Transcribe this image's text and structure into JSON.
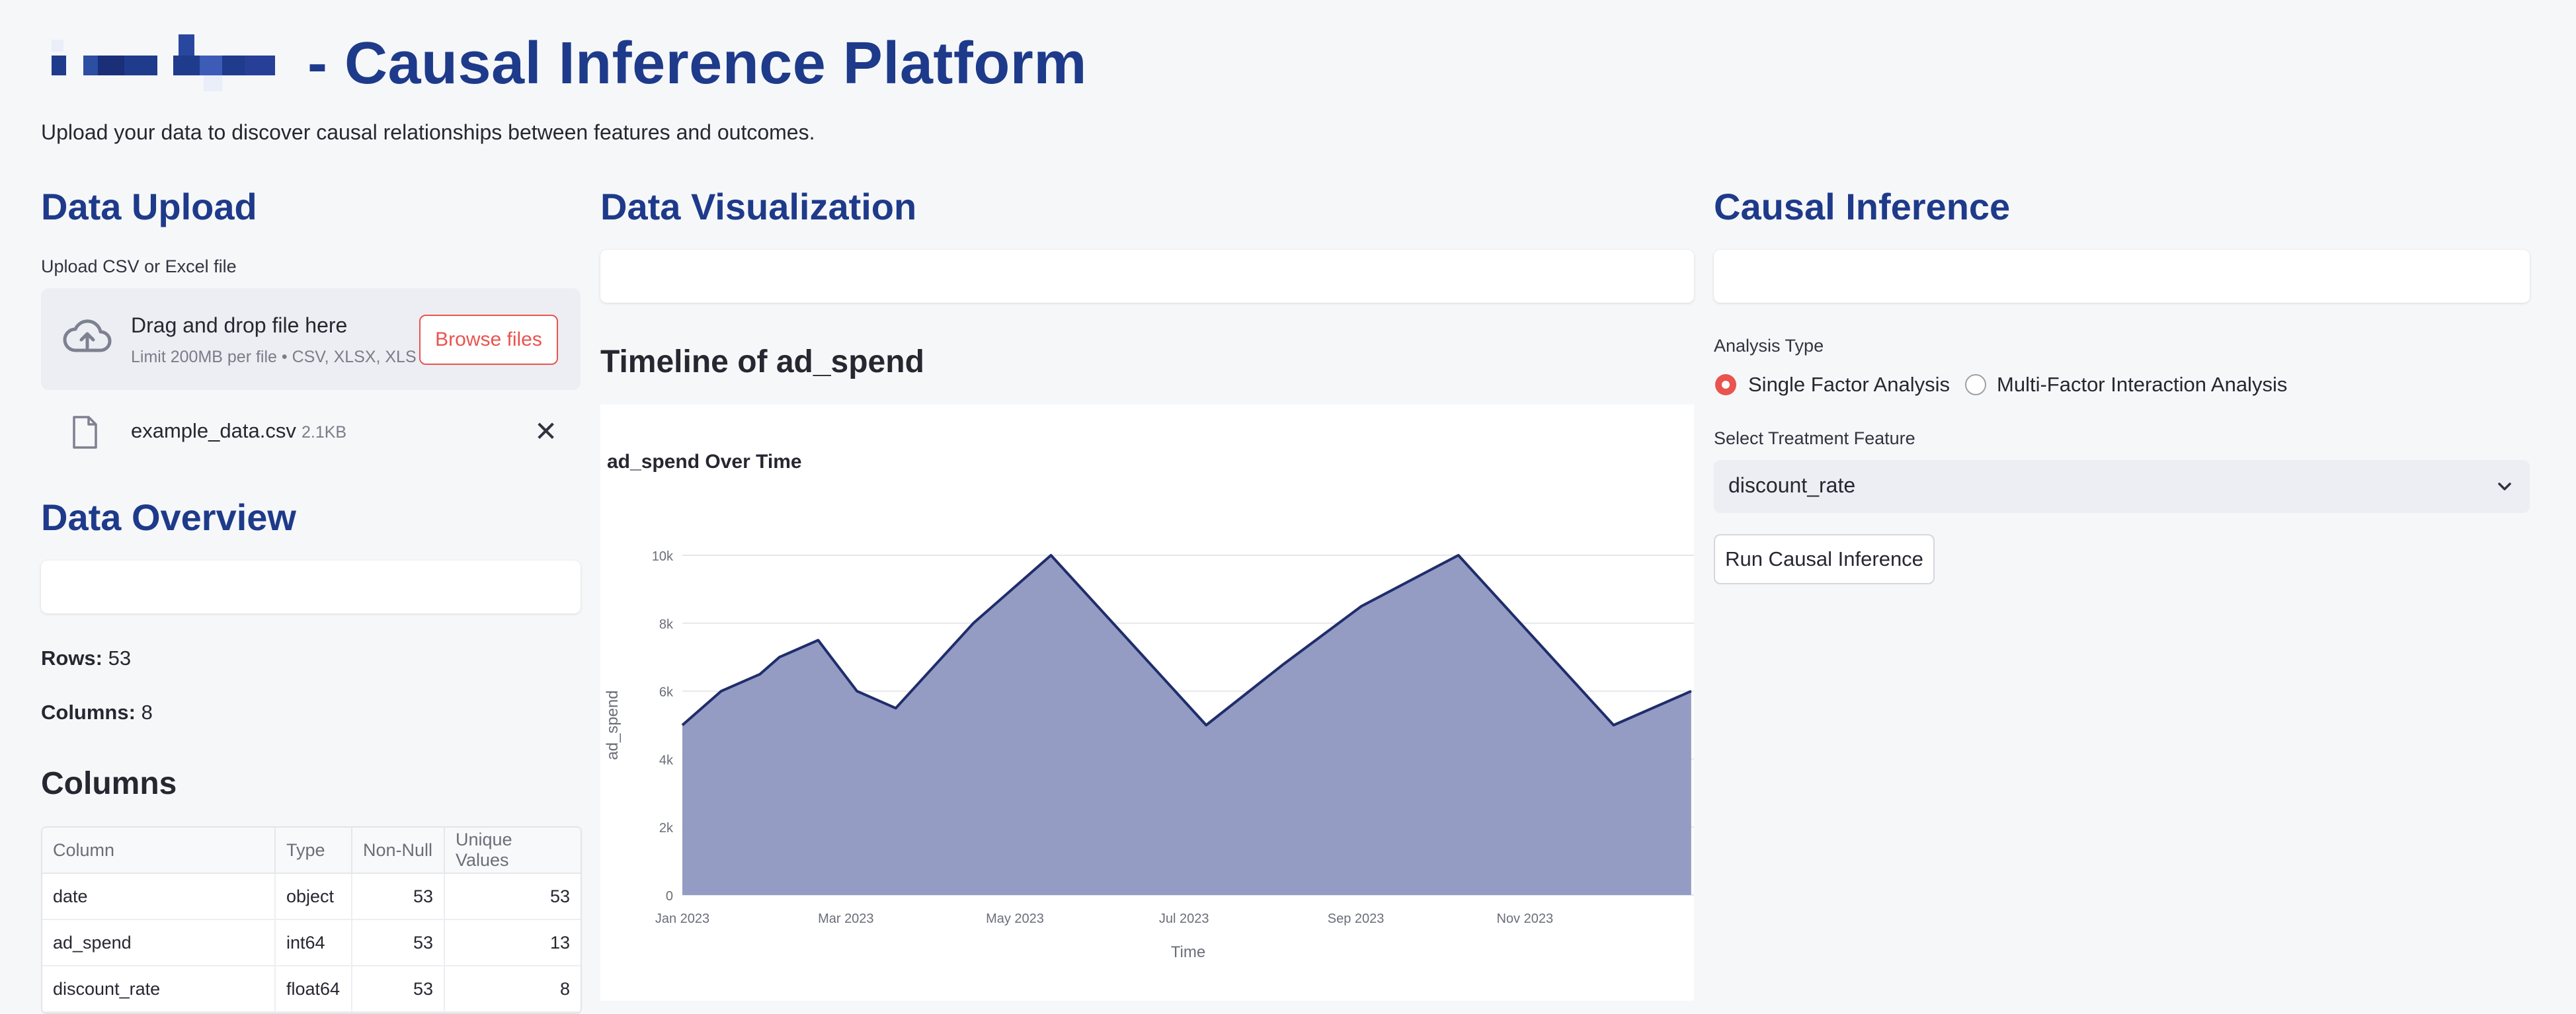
{
  "header": {
    "title": "- Causal Inference Platform",
    "subtitle": "Upload your data to discover causal relationships between features and outcomes."
  },
  "upload": {
    "heading": "Data Upload",
    "label": "Upload CSV or Excel file",
    "drop_text": "Drag and drop file here",
    "limit_text": "Limit 200MB per file • CSV, XLSX, XLS",
    "browse_label": "Browse files",
    "file_name": "example_data.csv",
    "file_size": "2.1KB",
    "close_glyph": "✕"
  },
  "overview": {
    "heading": "Data Overview",
    "rows_label": "Rows:",
    "rows_value": "53",
    "columns_label": "Columns:",
    "columns_value": "8"
  },
  "columns_section": {
    "heading": "Columns",
    "headers": [
      "Column",
      "Type",
      "Non-Null",
      "Unique Values"
    ],
    "rows": [
      [
        "date",
        "object",
        "53",
        "53"
      ],
      [
        "ad_spend",
        "int64",
        "53",
        "13"
      ],
      [
        "discount_rate",
        "float64",
        "53",
        "8"
      ]
    ]
  },
  "visualization": {
    "heading": "Data Visualization",
    "subheading": "Timeline of ad_spend"
  },
  "causal": {
    "heading": "Causal Inference",
    "analysis_type_label": "Analysis Type",
    "options": [
      "Single Factor Analysis",
      "Multi-Factor Interaction Analysis"
    ],
    "selected_option": "Single Factor Analysis",
    "treatment_label": "Select Treatment Feature",
    "treatment_value": "discount_rate",
    "run_label": "Run Causal Inference"
  },
  "colors": {
    "accent": "#e9544f",
    "heading_blue": "#1e3a8a",
    "area_fill": "#8e97c0",
    "line": "#1f2d6b"
  },
  "chart_data": {
    "type": "area",
    "title": "ad_spend Over Time",
    "xlabel": "Time",
    "ylabel": "ad_spend",
    "x_ticks": [
      "Jan 2023",
      "Mar 2023",
      "May 2023",
      "Jul 2023",
      "Sep 2023",
      "Nov 2023"
    ],
    "y_ticks": [
      "0",
      "2k",
      "4k",
      "6k",
      "8k",
      "10k"
    ],
    "ylim": [
      0,
      10000
    ],
    "grid": true,
    "series": [
      {
        "x": [
          "2023-01-01",
          "2023-01-15",
          "2023-01-29",
          "2023-02-05",
          "2023-02-19",
          "2023-03-05",
          "2023-03-19",
          "2023-04-16",
          "2023-05-14",
          "2023-06-11",
          "2023-07-09",
          "2023-08-06",
          "2023-09-03",
          "2023-10-08",
          "2023-11-05",
          "2023-12-03",
          "2023-12-31"
        ],
        "values": [
          5000,
          6000,
          6500,
          7000,
          7500,
          6000,
          5500,
          8000,
          10000,
          7500,
          5000,
          6800,
          8500,
          10000,
          7500,
          5000,
          6000
        ]
      }
    ]
  }
}
